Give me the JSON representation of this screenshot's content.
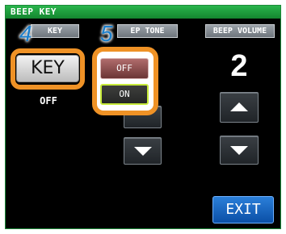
{
  "screen": {
    "title": "BEEP KEY",
    "columns": {
      "key": "KEY",
      "tone": "EP TONE",
      "volume": "BEEP VOLUME"
    }
  },
  "key": {
    "button_label": "KEY",
    "state": "OFF"
  },
  "tone": {
    "off_label": "OFF",
    "on_label": "ON",
    "selected": "ON"
  },
  "volume": {
    "value": "2"
  },
  "steps": {
    "key_step": "4",
    "tone_step": "5"
  },
  "exit": {
    "label": "EXIT"
  },
  "colors": {
    "title_bar": "#1f9d3f",
    "highlight_ring": "#ef9226",
    "step_number": "#1b7fcc",
    "selected_outline": "#c7ea3a",
    "exit_button": "#1466c4"
  },
  "icons": {
    "up": "up-arrow-icon",
    "down": "down-arrow-icon"
  }
}
